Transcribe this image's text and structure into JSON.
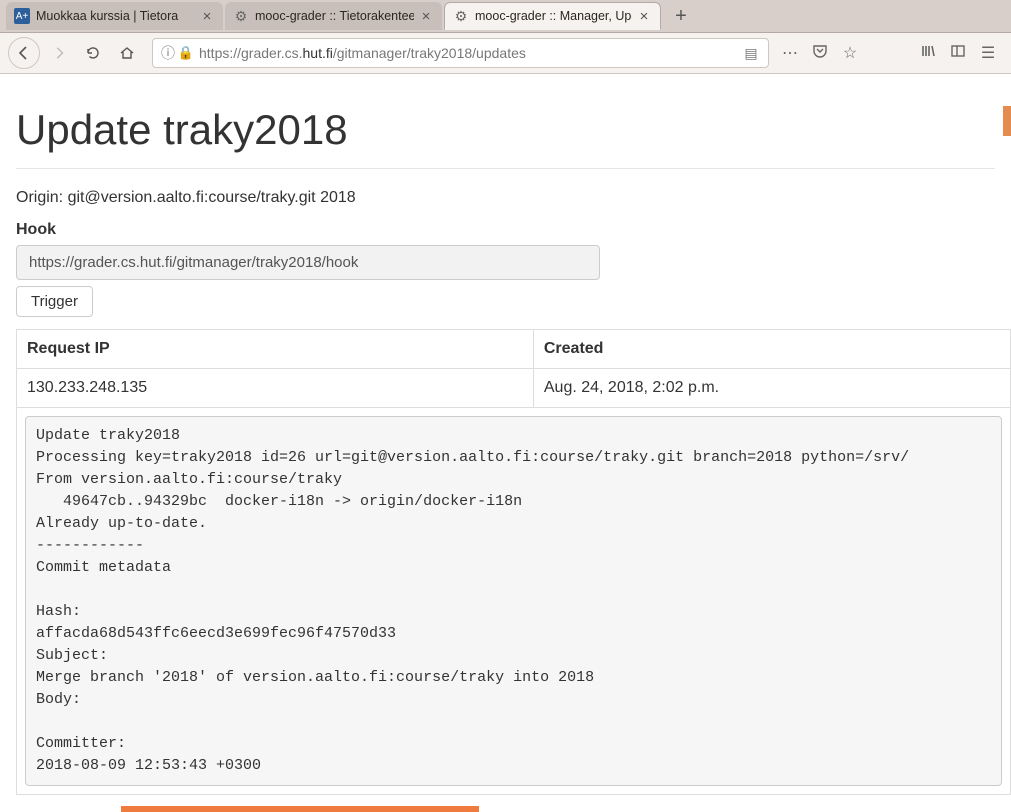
{
  "browser": {
    "tabs": [
      {
        "title": "Muokkaa kurssia | Tietora",
        "favicon": "A+"
      },
      {
        "title": "mooc-grader :: Tietorakentee",
        "favicon": "gear"
      },
      {
        "title": "mooc-grader :: Manager, Upd",
        "favicon": "gear"
      }
    ],
    "url_pre": "https://grader.cs.",
    "url_host": "hut.fi",
    "url_post": "/gitmanager/traky2018/updates"
  },
  "page": {
    "title": "Update traky2018",
    "origin": "Origin: git@version.aalto.fi:course/traky.git 2018",
    "hook_label": "Hook",
    "hook_url": "https://grader.cs.hut.fi/gitmanager/traky2018/hook",
    "trigger_label": "Trigger",
    "table": {
      "col_ip": "Request IP",
      "col_created": "Created",
      "row_ip": "130.233.248.135",
      "row_created": "Aug. 24, 2018, 2:02 p.m."
    },
    "log": "Update traky2018\nProcessing key=traky2018 id=26 url=git@version.aalto.fi:course/traky.git branch=2018 python=/srv/\nFrom version.aalto.fi:course/traky\n   49647cb..94329bc  docker-i18n -> origin/docker-i18n\nAlready up-to-date.\n------------\nCommit metadata\n\nHash:\naffacda68d543ffc6eecd3e699fec96f47570d33\nSubject:\nMerge branch '2018' of version.aalto.fi:course/traky into 2018\nBody:\n\nCommitter:\n2018-08-09 12:53:43 +0300"
  }
}
